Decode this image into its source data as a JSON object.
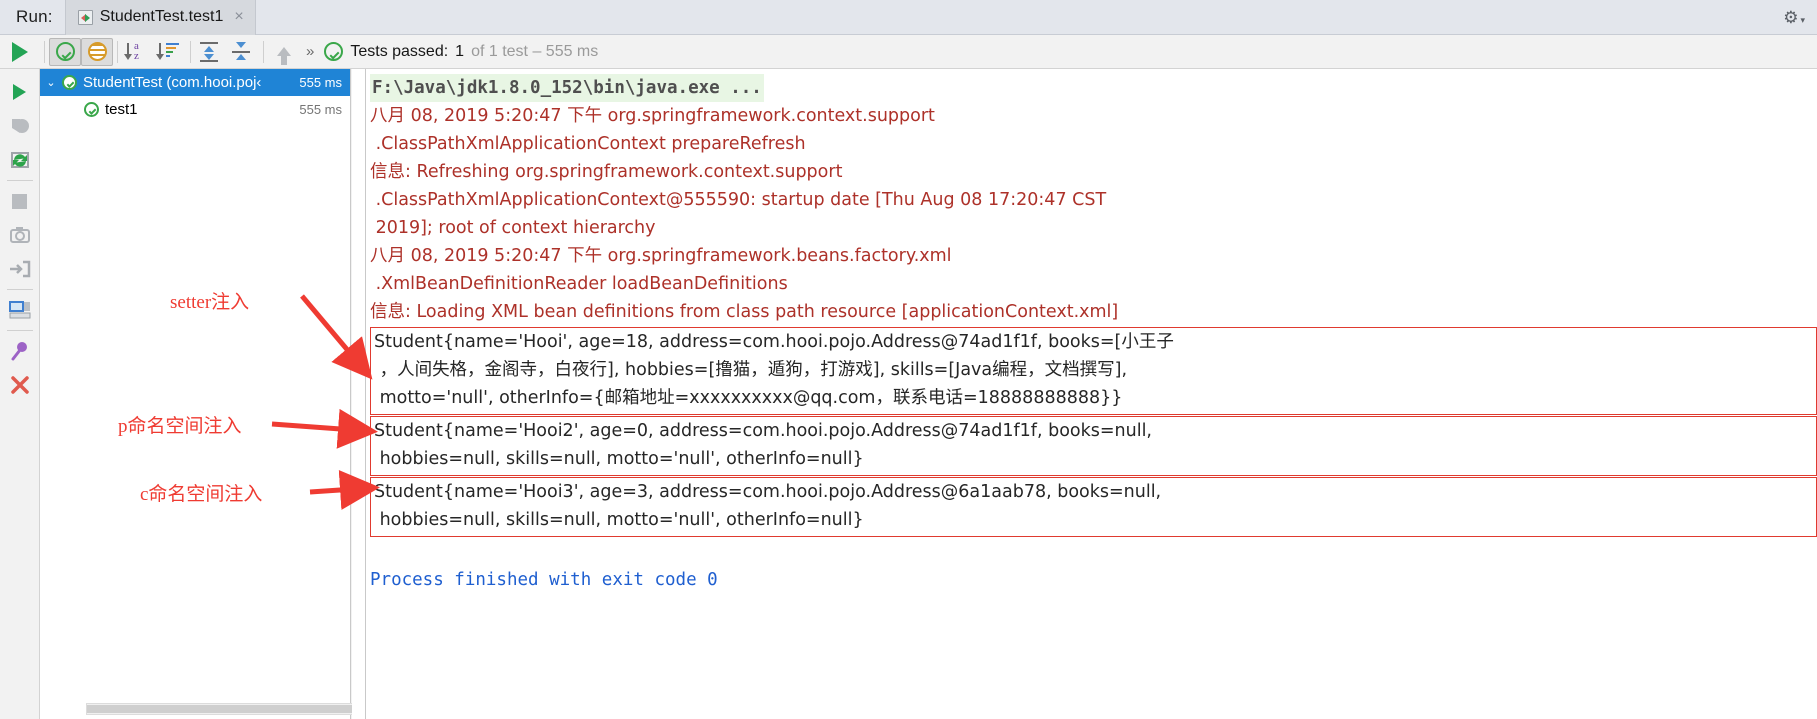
{
  "window": {
    "run_label": "Run:",
    "tab_title": "StudentTest.test1",
    "tab_close": "×",
    "gear": "⚙",
    "gear_caret": "▾"
  },
  "toolbar": {
    "rerun_icon": "run-triangle",
    "show_passed_icon": "ok-circle",
    "show_ignored_icon": "ignored-circle",
    "sort_alpha_icon": "sort-alphabetically",
    "sort_duration_icon": "sort-by-duration",
    "expand_all_icon": "expand-all",
    "collapse_all_icon": "collapse-all",
    "prev_fail_icon": "up-arrow",
    "overflow": "»",
    "status_prefix": "Tests passed:",
    "status_count": "1",
    "status_suffix": "of 1 test – 555 ms"
  },
  "gutter_icons": [
    "rerun-icon",
    "rerun-failed-icon",
    "toggle-auto-test-icon",
    "stop-icon",
    "screenshot-icon",
    "export-icon",
    "layout-icon",
    "pin-tab-icon",
    "close-icon"
  ],
  "tree": {
    "rows": [
      {
        "twisty": "⌄",
        "label": "StudentTest (com.hooi.poj‹",
        "time": "555 ms",
        "selected": true
      },
      {
        "twisty": "",
        "label": "test1",
        "time": "555 ms",
        "selected": false
      }
    ]
  },
  "console": {
    "command_line": "F:\\Java\\jdk1.8.0_152\\bin\\java.exe ...",
    "log_lines": [
      "八月 08, 2019 5:20:47 下午 org.springframework.context.support",
      " .ClassPathXmlApplicationContext prepareRefresh",
      "信息: Refreshing org.springframework.context.support",
      " .ClassPathXmlApplicationContext@555590: startup date [Thu Aug 08 17:20:47 CST",
      " 2019]; root of context hierarchy",
      "八月 08, 2019 5:20:47 下午 org.springframework.beans.factory.xml",
      " .XmlBeanDefinitionReader loadBeanDefinitions",
      "信息: Loading XML bean definitions from class path resource [applicationContext.xml]"
    ],
    "boxes": [
      {
        "name": "setter-injection-output",
        "lines": [
          "Student{name='Hooi', age=18, address=com.hooi.pojo.Address@74ad1f1f, books=[小王子",
          " ，人间失格，金阁寺，白夜行], hobbies=[撸猫，遁狗，打游戏], skills=[Java编程，文档撰写],",
          " motto='null', otherInfo={邮箱地址=xxxxxxxxxx@qq.com，联系电话=18888888888}}"
        ]
      },
      {
        "name": "p-namespace-injection-output",
        "lines": [
          "Student{name='Hooi2', age=0, address=com.hooi.pojo.Address@74ad1f1f, books=null,",
          " hobbies=null, skills=null, motto='null', otherInfo=null}"
        ]
      },
      {
        "name": "c-namespace-injection-output",
        "lines": [
          "Student{name='Hooi3', age=3, address=com.hooi.pojo.Address@6a1aab78, books=null,",
          " hobbies=null, skills=null, motto='null', otherInfo=null}"
        ]
      }
    ],
    "exit_line": "Process finished with exit code 0"
  },
  "annotations": [
    {
      "name": "setter-injection-annotation",
      "text": "setter注入"
    },
    {
      "name": "p-namespace-annotation",
      "text": "p命名空间注入"
    },
    {
      "name": "c-namespace-annotation",
      "text": "c命名空间注入"
    }
  ],
  "colors": {
    "annotation_red": "#ef3b32",
    "log_red": "#ad3129",
    "selection_blue": "#1f84d6",
    "success_green": "#3aa74a",
    "link_blue": "#1f5fd0"
  }
}
